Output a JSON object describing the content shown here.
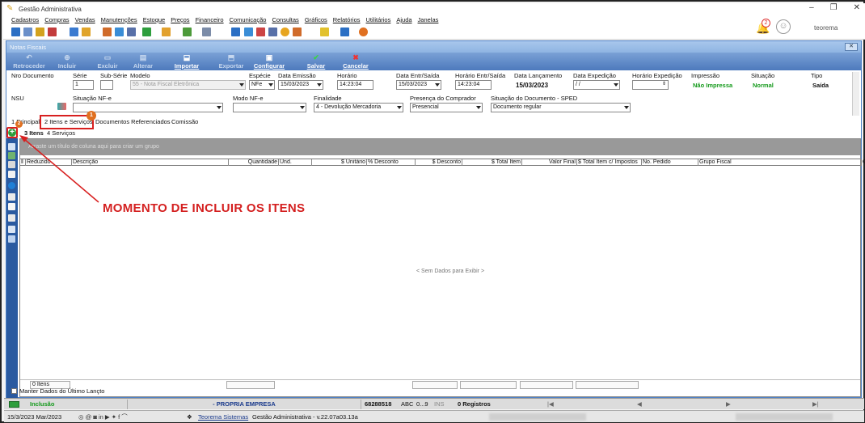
{
  "app": {
    "title": "Gestão Administrativa",
    "user": "teorema",
    "notif_count": "2"
  },
  "menu": [
    "Cadastros",
    "Compras",
    "Vendas",
    "Manutenções",
    "Estoque",
    "Preços",
    "Financeiro",
    "Comunicação",
    "Consultas",
    "Gráficos",
    "Relatórios",
    "Utilitários",
    "Ajuda",
    "Janelas"
  ],
  "child": {
    "title": "Notas Fiscais"
  },
  "ribbon": [
    {
      "label": "Retroceder",
      "on": false
    },
    {
      "label": "Incluir",
      "on": false
    },
    {
      "label": "Excluir",
      "on": false
    },
    {
      "label": "Alterar",
      "on": false
    },
    {
      "label": "Importar",
      "on": true
    },
    {
      "label": "Exportar",
      "on": false
    },
    {
      "label": "Configurar",
      "on": true
    },
    {
      "label": "Salvar",
      "on": true
    },
    {
      "label": "Cancelar",
      "on": true
    }
  ],
  "form": {
    "nro_documento": {
      "label": "Nro Documento"
    },
    "serie": {
      "label": "Série",
      "value": "1"
    },
    "sub_serie": {
      "label": "Sub-Série",
      "value": ""
    },
    "modelo": {
      "label": "Modelo",
      "value": "55 - Nota Fiscal Eletrônica"
    },
    "especie": {
      "label": "Espécie",
      "value": "NFe"
    },
    "data_emissao": {
      "label": "Data Emissão",
      "value": "15/03/2023"
    },
    "horario": {
      "label": "Horário",
      "value": "14:23:04"
    },
    "data_entr_saida": {
      "label": "Data Entr/Saída",
      "value": "15/03/2023"
    },
    "horario_entr_saida": {
      "label": "Horário Entr/Saída",
      "value": "14:23:04"
    },
    "data_lancamento": {
      "label": "Data Lançamento",
      "value": "15/03/2023"
    },
    "data_expedicao": {
      "label": "Data Expedição",
      "value": " / /"
    },
    "horario_expedicao": {
      "label": "Horário Expedição",
      "value": ""
    },
    "impressao": {
      "label": "Impressão",
      "value": "Não Impressa"
    },
    "situacao": {
      "label": "Situação",
      "value": "Normal"
    },
    "tipo": {
      "label": "Tipo",
      "value": "Saída"
    },
    "nsu": {
      "label": "NSU"
    },
    "situacao_nfe": {
      "label": "Situação NF-e",
      "value": ""
    },
    "modo_nfe": {
      "label": "Modo NF-e",
      "value": ""
    },
    "finalidade": {
      "label": "Finalidade",
      "value": "4 - Devolução Mercadoria"
    },
    "presenca": {
      "label": "Presença do Comprador",
      "value": "Presencial"
    },
    "situacao_sped": {
      "label": "Situação do Documento - SPED",
      "value": "Documento regular"
    }
  },
  "tabs": [
    "1 Principal",
    "2 Itens e Serviços",
    "Documentos Referenciados",
    "Comissão"
  ],
  "subtabs": [
    "3 Itens",
    "4 Serviços"
  ],
  "grid": {
    "group_hint": "Arraste um título de coluna aqui para criar um grupo",
    "columns": [
      "Reduzido",
      "Descrição",
      "Quantidade",
      "Und.",
      "$ Unitário",
      "% Desconto",
      "$ Desconto",
      "$ Total Item",
      "Valor Final",
      "$ Total Item c/ Impostos",
      "No. Pedido",
      "Grupo Fiscal",
      "G"
    ],
    "empty": "< Sem Dados para Exibir >",
    "footer_count": "0 Itens"
  },
  "manter": "Manter Dados do Último Lançto",
  "status": {
    "mode": "Inclusão",
    "company": "- PROPRIA EMPRESA",
    "code": "68288518",
    "abc": "ABC",
    "range": "0...9",
    "ins": "INS",
    "records": "0 Registros"
  },
  "bottom": {
    "date": "15/3/2023 Mar/2023",
    "company": "Teorema Sistemas",
    "version": "Gestão Administrativa - v.22.07a03.13a"
  },
  "annotation": {
    "text": "MOMENTO DE INCLUIR OS ITENS",
    "badge1": "1",
    "badge2": "2",
    "add": "+"
  },
  "colors": {
    "accent": "#4d79bc",
    "annotation": "#d82020",
    "badge": "#e07020",
    "green": "#159a1c"
  }
}
